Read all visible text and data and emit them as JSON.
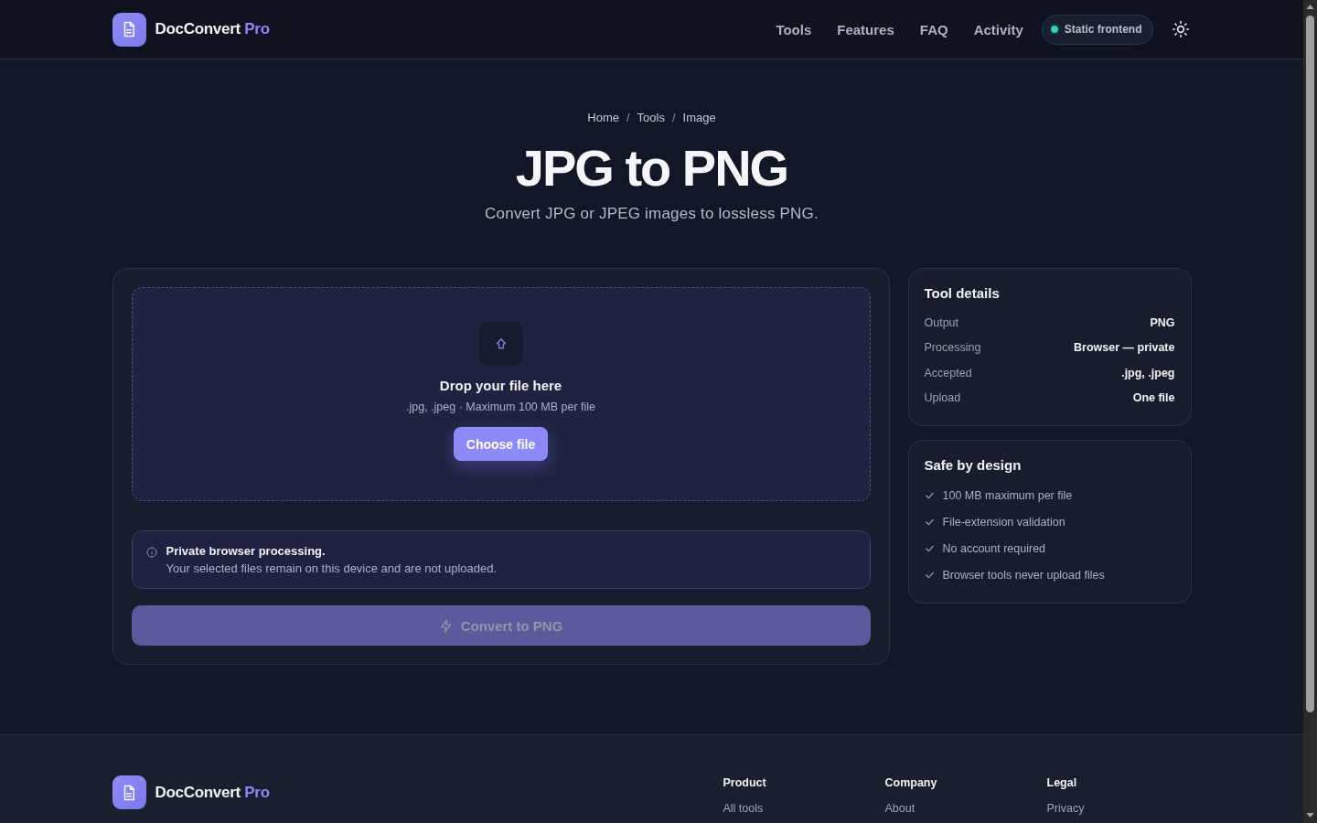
{
  "header": {
    "brand": {
      "name": "DocConvert",
      "suffix": "Pro"
    },
    "nav": [
      {
        "label": "Tools"
      },
      {
        "label": "Features"
      },
      {
        "label": "FAQ"
      },
      {
        "label": "Activity"
      }
    ],
    "status_badge": {
      "label": "Static frontend"
    }
  },
  "breadcrumb": [
    {
      "label": "Home",
      "separator": "/"
    },
    {
      "label": "Tools",
      "separator": "/"
    },
    {
      "label": "Image"
    }
  ],
  "hero": {
    "title": "JPG to PNG",
    "subtitle": "Convert JPG or JPEG images to lossless PNG."
  },
  "dropzone": {
    "title": "Drop your file here",
    "hint": ".jpg, .jpeg · Maximum 100 MB per file",
    "button": "Choose file"
  },
  "notice": {
    "title": "Private browser processing.",
    "text": "Your selected files remain on this device and are not uploaded."
  },
  "convert_button": {
    "label": "Convert to PNG",
    "disabled": true
  },
  "tool_details": {
    "title": "Tool details",
    "rows": [
      {
        "label": "Output",
        "value": "PNG"
      },
      {
        "label": "Processing",
        "value": "Browser — private"
      },
      {
        "label": "Accepted",
        "value": ".jpg, .jpeg"
      },
      {
        "label": "Upload",
        "value": "One file"
      }
    ]
  },
  "safety": {
    "title": "Safe by design",
    "items": [
      "100 MB maximum per file",
      "File-extension validation",
      "No account required",
      "Browser tools never upload files"
    ]
  },
  "footer": {
    "brand": {
      "name": "DocConvert",
      "suffix": "Pro"
    },
    "columns": [
      {
        "title": "Product",
        "links": [
          "All tools"
        ]
      },
      {
        "title": "Company",
        "links": [
          "About"
        ]
      },
      {
        "title": "Legal",
        "links": [
          "Privacy"
        ]
      }
    ]
  }
}
